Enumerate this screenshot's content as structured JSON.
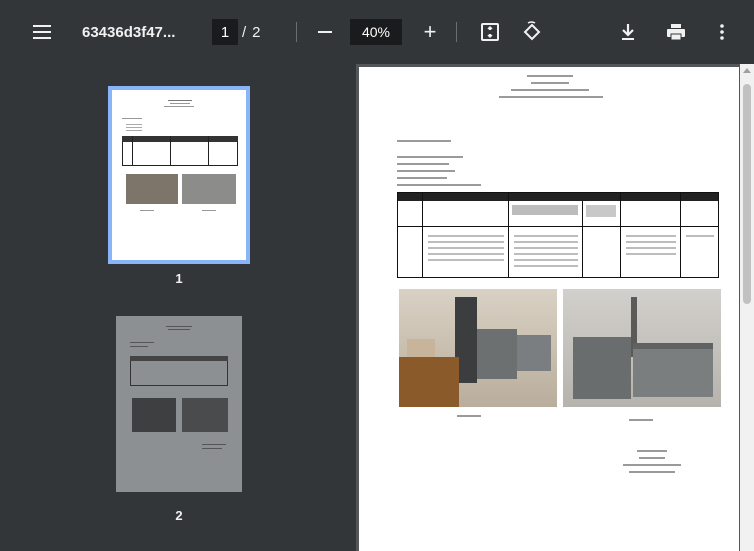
{
  "toolbar": {
    "title": "63436d3f47...",
    "current_page": "1",
    "page_separator": "/",
    "total_pages": "2",
    "zoom": "40%",
    "zoom_in_label": "+",
    "icons": [
      "menu-icon",
      "zoom-out-icon",
      "zoom-in-icon",
      "fit-page-icon",
      "rotate-icon",
      "download-icon",
      "print-icon",
      "more-icon"
    ]
  },
  "sidebar": {
    "thumbnails": [
      {
        "label": "1",
        "selected": true
      },
      {
        "label": "2",
        "selected": false
      }
    ],
    "accent": "#8ab4f8"
  },
  "colors": {
    "toolbar_bg": "#323639",
    "viewer_bg": "#525659",
    "page_bg": "#ffffff"
  }
}
